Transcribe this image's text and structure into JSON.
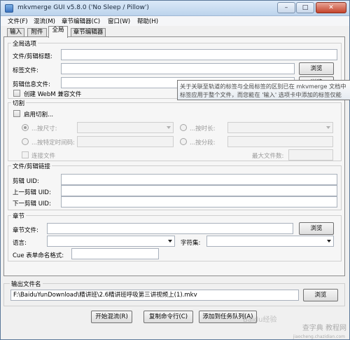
{
  "window": {
    "title": "mkvmerge GUI v5.8.0 ('No Sleep / Pillow')",
    "min": "–",
    "max": "□",
    "close": "✕"
  },
  "menu": [
    "文件(F)",
    "混流(M)",
    "章节编辑器(C)",
    "窗口(W)",
    "帮助(H)"
  ],
  "tabs": [
    "输入",
    "附件",
    "全局",
    "章节编辑器"
  ],
  "global_options": {
    "title": "全局选项",
    "file_title_label": "文件/剪辑标题:",
    "file_title_value": "",
    "tags_label": "标签文件:",
    "tags_value": "",
    "tags_browse": "浏览",
    "segment_info_label": "剪辑信息文件:",
    "segment_info_value": "",
    "segment_info_browse": "浏览",
    "webm_label": "创建 WebM 兼容文件"
  },
  "tooltip": {
    "line1": "关于关联至轨道的标签与全局标签的区别已在 mkvmerge 文档中",
    "line2": "标签应用于整个文件，而您能在 '输入' 选项卡中添加的标签仅能"
  },
  "split": {
    "title": "切割",
    "enable_label": "启用切割...",
    "by_size_label": "...按尺寸:",
    "by_duration_label": "...按时长:",
    "by_timecodes_label": "...按特定时间码:",
    "by_parts_label": "...按分段:",
    "link_files_label": "连接文件",
    "max_files_label": "最大文件数:"
  },
  "linking": {
    "title": "文件/剪辑链接",
    "segment_uid_label": "剪辑 UID:",
    "prev_uid_label": "上一剪辑 UID:",
    "next_uid_label": "下一剪辑 UID:"
  },
  "chapters": {
    "title": "章节",
    "file_label": "章节文件:",
    "file_value": "",
    "browse": "浏览",
    "language_label": "语言:",
    "language_value": "",
    "charset_label": "字符集:",
    "charset_value": "",
    "cue_label": "Cue 表单命名格式:",
    "cue_value": ""
  },
  "output": {
    "title": "输出文件名",
    "path": "F:\\BaiduYunDownload\\精讲班\\2.6精讲班呼吸第三讲视频上(1).mkv",
    "browse": "浏览"
  },
  "buttons": {
    "start": "开始混流(R)",
    "copy_cmd": "复制命令行(C)",
    "add_queue": "添加到任务队列(A)"
  },
  "watermark": {
    "main": "查字典 教程网",
    "sub": "jiaocheng.chazidian.com",
    "baidu": "Baidu经验"
  }
}
